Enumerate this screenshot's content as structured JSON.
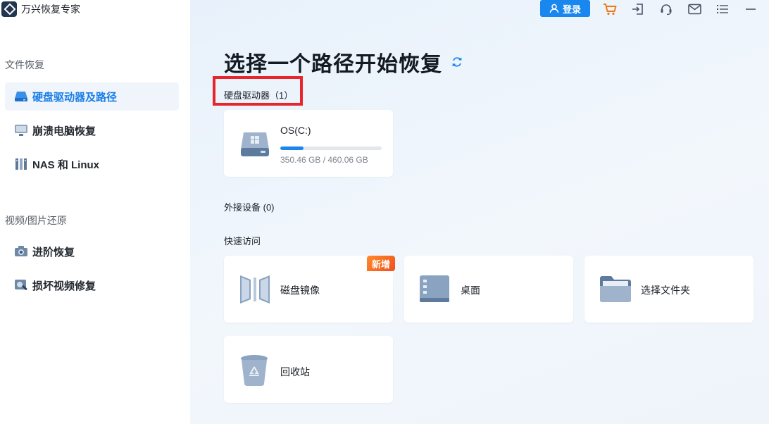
{
  "app": {
    "title": "万兴恢复专家"
  },
  "sidebar": {
    "section_file": "文件恢复",
    "section_video": "视频/图片还原",
    "items": [
      {
        "label": "硬盘驱动器及路径",
        "icon": "hard-drive-icon",
        "active": true
      },
      {
        "label": "崩溃电脑恢复",
        "icon": "monitor-icon",
        "active": false
      },
      {
        "label": "NAS 和 Linux",
        "icon": "nas-icon",
        "active": false
      },
      {
        "label": "进阶恢复",
        "icon": "camera-icon",
        "active": false
      },
      {
        "label": "损坏视频修复",
        "icon": "video-repair-icon",
        "active": false
      }
    ]
  },
  "topbar": {
    "login_label": "登录",
    "icons": [
      "cart-icon",
      "sign-in-icon",
      "headset-icon",
      "mail-icon",
      "menu-icon",
      "minimize-icon"
    ]
  },
  "main": {
    "title": "选择一个路径开始恢复",
    "drives_label": "硬盘驱动器（1）",
    "drives": [
      {
        "name": "OS(C:)",
        "size_text": "350.46 GB / 460.06 GB",
        "used_fraction": 0.2275
      }
    ],
    "external_label": "外接设备 (0)",
    "quick_label": "快速访问",
    "quick_access": [
      {
        "label": "磁盘镜像",
        "icon": "disk-image-icon",
        "badge": "新增"
      },
      {
        "label": "桌面",
        "icon": "desktop-icon"
      },
      {
        "label": "选择文件夹",
        "icon": "folder-icon"
      },
      {
        "label": "回收站",
        "icon": "recycle-bin-icon"
      }
    ]
  },
  "colors": {
    "accent": "#1a87ee",
    "highlight": "#e8242c",
    "badge": "#f26522"
  }
}
